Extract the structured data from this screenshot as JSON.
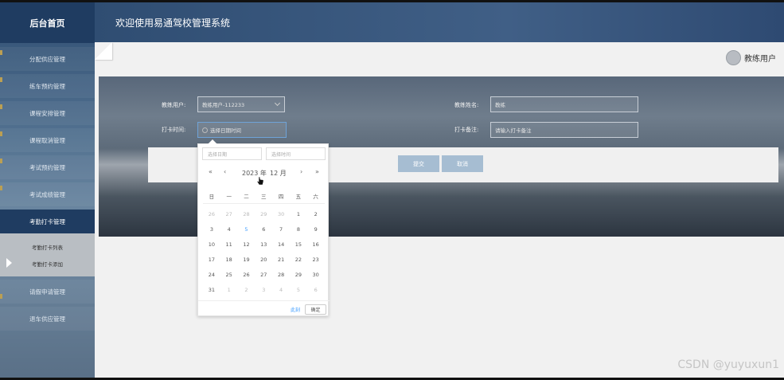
{
  "app": {
    "brand": "后台首页",
    "header_title": "欢迎使用易通驾校管理系统",
    "user_name": "教练用户"
  },
  "sidebar": {
    "items": [
      {
        "label": "分配供应管理"
      },
      {
        "label": "练车预约管理"
      },
      {
        "label": "课程安排管理"
      },
      {
        "label": "课程取消管理"
      },
      {
        "label": "考试预约管理"
      },
      {
        "label": "考试成绩管理"
      },
      {
        "label": "考勤打卡管理"
      },
      {
        "label": "请假申请管理"
      },
      {
        "label": "退车供应管理"
      }
    ],
    "sub_items": [
      {
        "label": "考勤打卡列表"
      },
      {
        "label": "考勤打卡添加"
      }
    ]
  },
  "form": {
    "coach_user_label": "教练用户:",
    "coach_user_value": "教练用户-112233",
    "coach_name_label": "教练姓名:",
    "coach_name_value": "教练",
    "punch_time_label": "打卡时间:",
    "punch_time_placeholder": "选择日期时间",
    "punch_note_label": "打卡备注:",
    "punch_note_placeholder": "请输入打卡备注",
    "submit_label": "提交",
    "cancel_label": "取消"
  },
  "datepicker": {
    "date_placeholder": "选择日期",
    "time_placeholder": "选择时间",
    "year_label": "2023 年",
    "month_label": "12 月",
    "prev_year": "«",
    "prev_month": "‹",
    "next_month": "›",
    "next_year": "»",
    "weekdays": [
      "日",
      "一",
      "二",
      "三",
      "四",
      "五",
      "六"
    ],
    "weeks": [
      [
        {
          "d": "26",
          "other": true
        },
        {
          "d": "27",
          "other": true
        },
        {
          "d": "28",
          "other": true
        },
        {
          "d": "29",
          "other": true
        },
        {
          "d": "30",
          "other": true
        },
        {
          "d": "1"
        },
        {
          "d": "2"
        }
      ],
      [
        {
          "d": "3"
        },
        {
          "d": "4"
        },
        {
          "d": "5",
          "today": true
        },
        {
          "d": "6"
        },
        {
          "d": "7"
        },
        {
          "d": "8"
        },
        {
          "d": "9"
        }
      ],
      [
        {
          "d": "10"
        },
        {
          "d": "11"
        },
        {
          "d": "12"
        },
        {
          "d": "13"
        },
        {
          "d": "14"
        },
        {
          "d": "15"
        },
        {
          "d": "16"
        }
      ],
      [
        {
          "d": "17"
        },
        {
          "d": "18"
        },
        {
          "d": "19"
        },
        {
          "d": "20"
        },
        {
          "d": "21"
        },
        {
          "d": "22"
        },
        {
          "d": "23"
        }
      ],
      [
        {
          "d": "24"
        },
        {
          "d": "25"
        },
        {
          "d": "26"
        },
        {
          "d": "27"
        },
        {
          "d": "28"
        },
        {
          "d": "29"
        },
        {
          "d": "30"
        }
      ],
      [
        {
          "d": "31"
        },
        {
          "d": "1",
          "other": true
        },
        {
          "d": "2",
          "other": true
        },
        {
          "d": "3",
          "other": true
        },
        {
          "d": "4",
          "other": true
        },
        {
          "d": "5",
          "other": true
        },
        {
          "d": "6",
          "other": true
        }
      ]
    ],
    "now_label": "此刻",
    "ok_label": "确定"
  },
  "watermark": "CSDN @yuyuxun1",
  "colors": {
    "sidebar_dark": "#1f3c61",
    "accent": "#409eff",
    "button": "#a6bdd2"
  },
  "icons": [
    "avatar-icon",
    "clock-icon",
    "chevron-down-icon",
    "caret-right-icon",
    "pointer-cursor-icon"
  ]
}
